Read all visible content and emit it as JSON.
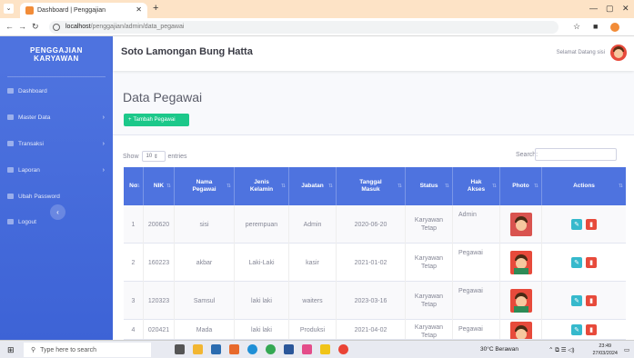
{
  "browser": {
    "tab_title": "Dashboard | Penggajian",
    "url_host": "localhost",
    "url_path": "/penggajian/admin/data_pegawai"
  },
  "sidebar": {
    "brand_line1": "PENGGAJIAN",
    "brand_line2": "KARYAWAN",
    "items": [
      {
        "label": "Dashboard",
        "chevron": ""
      },
      {
        "label": "Master Data",
        "chevron": "›"
      },
      {
        "label": "Transaksi",
        "chevron": "›"
      },
      {
        "label": "Laporan",
        "chevron": "›"
      },
      {
        "label": "Ubah Password",
        "chevron": ""
      },
      {
        "label": "Logout",
        "chevron": ""
      }
    ],
    "toggle": "‹"
  },
  "topbar": {
    "app_name": "Soto Lamongan Bung Hatta",
    "welcome": "Selamat Datang sisi"
  },
  "page": {
    "title": "Data Pegawai",
    "add_button": "Tambah Pegawai",
    "show_label": "Show",
    "entries_value": "10",
    "entries_label": "entries",
    "search_label": "Search:"
  },
  "table": {
    "headers": [
      "No",
      "NIK",
      "Nama Pegawai",
      "Jenis Kelamin",
      "Jabatan",
      "Tanggal Masuk",
      "Status",
      "Hak Akses",
      "Photo",
      "Actions"
    ],
    "rows": [
      {
        "no": "1",
        "nik": "200620",
        "nama": "sisi",
        "jk": "perempuan",
        "jabatan": "Admin",
        "tanggal": "2020-06-20",
        "status": "Karyawan Tetap",
        "akses": "Admin"
      },
      {
        "no": "2",
        "nik": "160223",
        "nama": "akbar",
        "jk": "Laki-Laki",
        "jabatan": "kasir",
        "tanggal": "2021-01-02",
        "status": "Karyawan Tetap",
        "akses": "Pegawai"
      },
      {
        "no": "3",
        "nik": "120323",
        "nama": "Samsul",
        "jk": "laki laki",
        "jabatan": "waiters",
        "tanggal": "2023-03-16",
        "status": "Karyawan Tetap",
        "akses": "Pegawai"
      },
      {
        "no": "4",
        "nik": "020421",
        "nama": "Mada",
        "jk": "laki laki",
        "jabatan": "Produksi",
        "tanggal": "2021-04-02",
        "status": "Karyawan Tetap",
        "akses": "Pegawai"
      }
    ]
  },
  "taskbar": {
    "search_placeholder": "Type here to search",
    "weather": "30°C Berawan",
    "time": "23:49",
    "date": "27/03/2024"
  },
  "colors": {
    "primary": "#4e73df",
    "success": "#1cc88a",
    "danger": "#e74a3b",
    "info": "#36b9cc"
  }
}
